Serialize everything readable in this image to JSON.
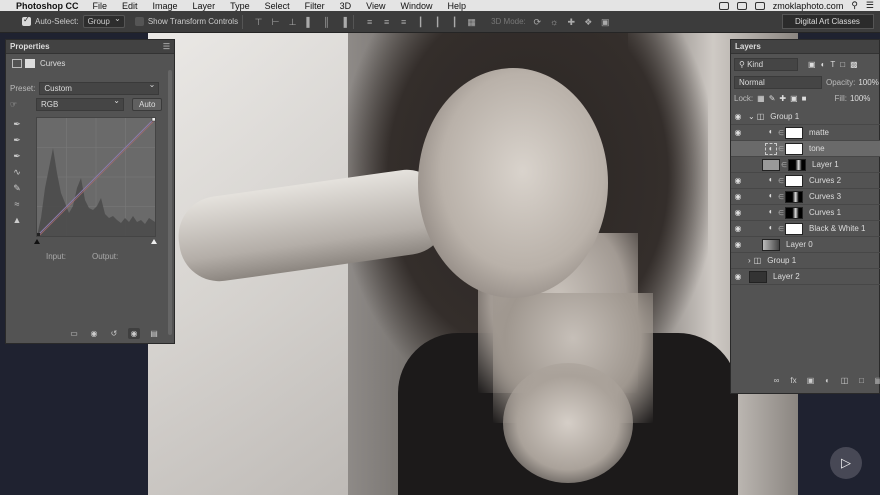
{
  "menubar": {
    "app": "Photoshop CC",
    "items": [
      "File",
      "Edit",
      "Image",
      "Layer",
      "Type",
      "Select",
      "Filter",
      "3D",
      "View",
      "Window",
      "Help"
    ],
    "user": "zmoklaphoto.com"
  },
  "options": {
    "auto_select_label": "Auto-Select:",
    "auto_select_value": "Group",
    "transform_label": "Show Transform Controls",
    "mode3d_label": "3D Mode:",
    "workspace": "Digital Art Classes"
  },
  "properties": {
    "title": "Properties",
    "adjustment": "Curves",
    "preset_label": "Preset:",
    "preset_value": "Custom",
    "channel": "RGB",
    "auto_label": "Auto",
    "input_label": "Input:",
    "output_label": "Output:"
  },
  "layers": {
    "title": "Layers",
    "kind": "Kind",
    "blend": "Normal",
    "opacity_label": "Opacity:",
    "opacity_value": "100%",
    "lock_label": "Lock:",
    "fill_label": "Fill:",
    "fill_value": "100%",
    "rows": [
      {
        "name": "Group 1"
      },
      {
        "name": "matte"
      },
      {
        "name": "tone"
      },
      {
        "name": "Layer 1"
      },
      {
        "name": "Curves 2"
      },
      {
        "name": "Curves 3"
      },
      {
        "name": "Curves 1"
      },
      {
        "name": "Black & White 1"
      },
      {
        "name": "Layer 0"
      },
      {
        "name": "Group 1"
      },
      {
        "name": "Layer 2"
      }
    ]
  }
}
